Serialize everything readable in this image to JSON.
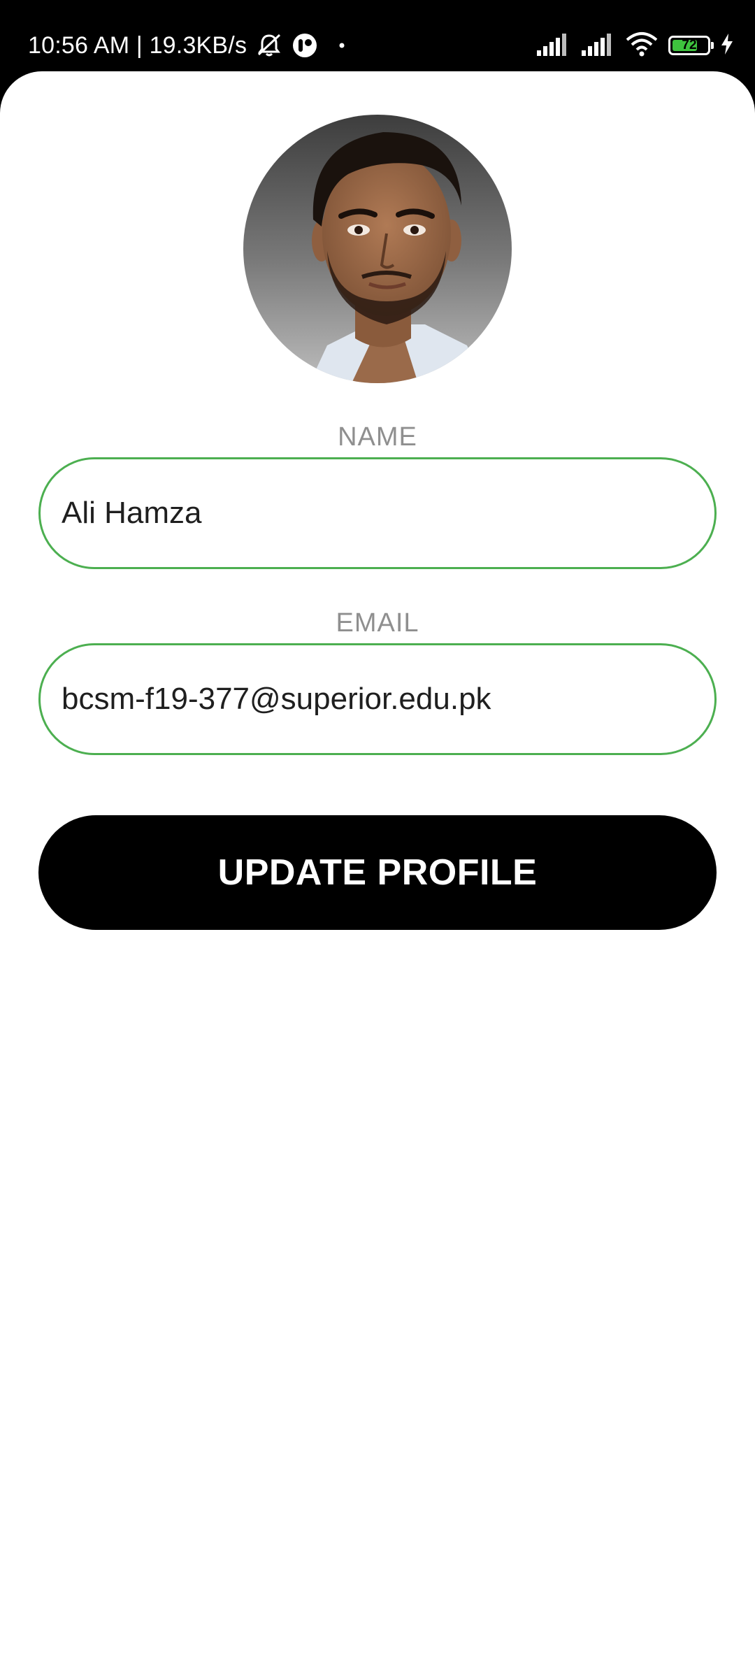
{
  "status_bar": {
    "time_speed": "10:56 AM | 19.3KB/s",
    "battery_level": "72",
    "battery_fraction": 0.72,
    "icons": [
      "muted-notifications-icon",
      "app-notification-icon",
      "dot-icon",
      "signal-icon",
      "signal-icon",
      "wifi-icon",
      "battery-icon",
      "charging-icon"
    ]
  },
  "profile": {
    "avatar": "profile-photo",
    "name_label": "NAME",
    "name_value": "Ali Hamza",
    "email_label": "EMAIL",
    "email_value": "bcsm-f19-377@superior.edu.pk",
    "update_button_label": "UPDATE PROFILE"
  },
  "colors": {
    "field_border": "#4caf50",
    "label": "#8f8f8f",
    "button_bg": "#000000",
    "button_text": "#ffffff",
    "battery_fill": "#3ec33e"
  }
}
